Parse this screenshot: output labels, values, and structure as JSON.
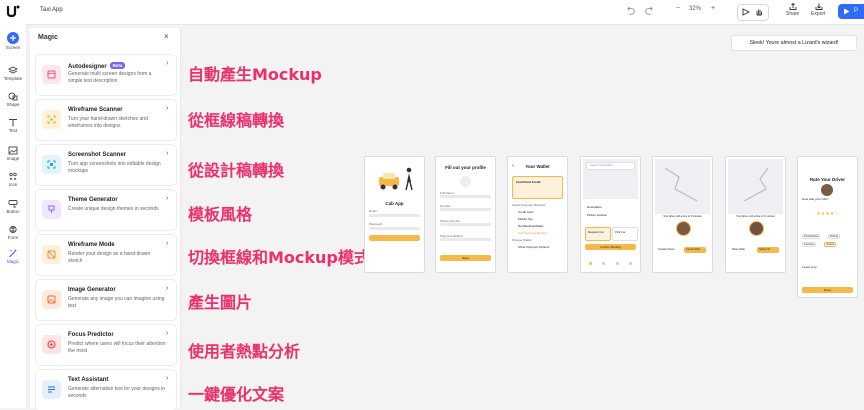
{
  "app": {
    "title": "Taxi App"
  },
  "toolbar": {
    "zoom_minus": "−",
    "zoom_value": "32%",
    "zoom_plus": "+",
    "share_label": "Share",
    "export_label": "Export",
    "play_label": "P",
    "accent": "#2f6bff"
  },
  "rail": {
    "items": [
      {
        "label": "Screen",
        "icon": "plus-icon"
      },
      {
        "label": "Template",
        "icon": "layers-icon"
      },
      {
        "label": "Shape",
        "icon": "shape-icon"
      },
      {
        "label": "Text",
        "icon": "text-icon"
      },
      {
        "label": "Image",
        "icon": "image-icon"
      },
      {
        "label": "Icon",
        "icon": "icon-grid-icon"
      },
      {
        "label": "Button",
        "icon": "button-icon"
      },
      {
        "label": "Form",
        "icon": "form-icon"
      },
      {
        "label": "Magic",
        "icon": "magic-wand-icon"
      }
    ]
  },
  "panel": {
    "title": "Magic",
    "close": "×",
    "items": [
      {
        "title": "Autodesigner",
        "badge": "Beta",
        "desc": "Generate multi screen designs from a simple text description",
        "icon_color": "#fde6ec"
      },
      {
        "title": "Wireframe Scanner",
        "desc": "Turn your hand-drawn sketches and wireframes into designs",
        "icon_color": "#fff2d9"
      },
      {
        "title": "Screenshot Scanner",
        "desc": "Turn app screenshots into editable design mockups",
        "icon_color": "#e2f3fb"
      },
      {
        "title": "Theme Generator",
        "desc": "Create unique design themes in seconds",
        "icon_color": "#efe7ff"
      },
      {
        "title": "Wireframe Mode",
        "desc": "Render your design as a hand-drawn sketch",
        "icon_color": "#fff0dc"
      },
      {
        "title": "Image Generator",
        "desc": "Generate any image you can imagine using text",
        "icon_color": "#ffe8dc"
      },
      {
        "title": "Focus Predictor",
        "desc": "Predict where users will focus their attention the most",
        "icon_color": "#ffe4e4"
      },
      {
        "title": "Text Assistant",
        "desc": "Generate alternative text for your designs in seconds",
        "icon_color": "#e4f0ff"
      }
    ]
  },
  "annotations": [
    "自動產生Mockup",
    "從框線稿轉換",
    "從設計稿轉換",
    "模板風格",
    "切換框線和Mockup模式",
    "產生圖片",
    "使用者熱點分析",
    "一鍵優化文案"
  ],
  "canvas": {
    "toast": "Sleek! Youre almost a Lizard's wizard!",
    "screens": [
      {
        "title": "Cab App",
        "field1": "Email",
        "field2": "Password"
      },
      {
        "title": "Fill out your profile",
        "field1": "Full Name",
        "field2": "Number",
        "field3": "Phone Number",
        "field4": "Payment Method",
        "button": "Save"
      },
      {
        "title": "Your Wallet",
        "card": "Cash/Card Credit",
        "section": "Select Payment Methods",
        "m1": "Credit Card",
        "m2": "Mobile Pay",
        "m3": "Net Banking/Wallet",
        "m4": "Add Payment Method",
        "section2": "Choose Wallet",
        "w1": "Other Payment Options",
        "button": "Confirm"
      },
      {
        "search": "Search Destination",
        "o1": "Destination",
        "o2": "Pickup location",
        "b1": "Request Car",
        "b2": "Pick Car",
        "button": "Confirm Booking"
      },
      {
        "caption": "Your driver will arrive in 5 minutes",
        "b1": "Contact Driver",
        "b2": "Cancel Ride"
      },
      {
        "caption": "Your driver will arrive in 5 minutes",
        "b1": "Share Ride",
        "b2": "Safety Kit"
      },
      {
        "title": "Rate Your Driver",
        "q": "How was your ride?",
        "tag1": "Professional",
        "tag2": "Driving",
        "tag3": "Courtesy",
        "tag4": "Vehicle",
        "tip": "Leave a tip",
        "button": "Done"
      }
    ]
  }
}
